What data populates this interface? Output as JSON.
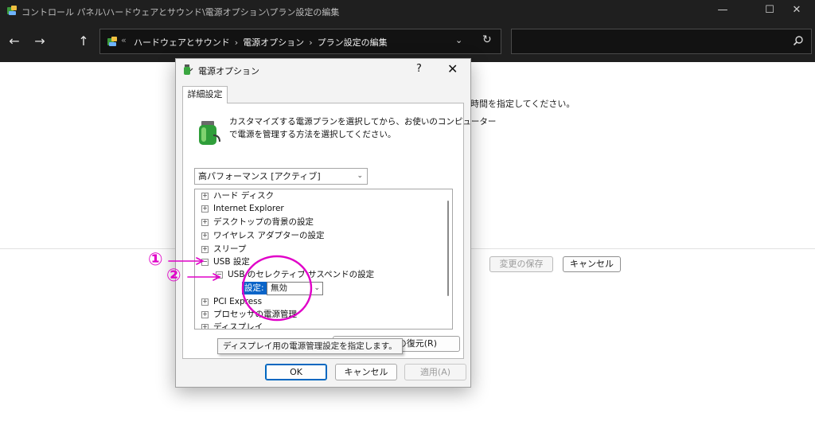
{
  "window": {
    "title": "コントロール パネル\\ハードウェアとサウンド\\電源オプション\\プラン設定の編集",
    "minimize": "—",
    "maximize": "☐",
    "close": "✕"
  },
  "nav": {
    "back": "←",
    "forward": "→",
    "up": "↑",
    "address_prefix": "«",
    "breadcrumbs": [
      "ハードウェアとサウンド",
      "電源オプション",
      "プラン設定の編集"
    ],
    "crumb_separator": "›",
    "dropdown": "⌄",
    "refresh": "↻",
    "search_placeholder": ""
  },
  "background": {
    "instruction_text": "時間を指定してください。",
    "save_button": "変更の保存",
    "cancel_button": "キャンセル"
  },
  "dialog": {
    "title": "電源オプション",
    "help": "?",
    "close": "✕",
    "tab": "詳細設定",
    "description_line1": "カスタマイズする電源プランを選択してから、お使いのコンピューター",
    "description_line2": "で電源を管理する方法を選択してください。",
    "plan_selected": "高パフォーマンス [アクティブ]",
    "tree": {
      "hard_disk": "ハード ディスク",
      "internet_explorer": "Internet Explorer",
      "desktop_background": "デスクトップの背景の設定",
      "wireless_adapter": "ワイヤレス アダプターの設定",
      "sleep": "スリープ",
      "usb_settings": "USB 設定",
      "usb_selective_suspend": "USB のセレクティブ サスペンドの設定",
      "setting_label": "設定:",
      "setting_value": "無効",
      "pci_express": "PCI Express",
      "processor_power": "プロセッサの電源管理",
      "display": "ディスプレイ"
    },
    "expand_symbol": "⊞",
    "collapse_symbol": "⊟",
    "restore_button": "ンの復元(R)",
    "tooltip": "ディスプレイ用の電源管理設定を指定します。",
    "ok_button": "OK",
    "cancel_button": "キャンセル",
    "apply_button": "適用(A)"
  },
  "annotations": {
    "marker1": "①",
    "marker2": "②",
    "color": "#e000c8"
  }
}
